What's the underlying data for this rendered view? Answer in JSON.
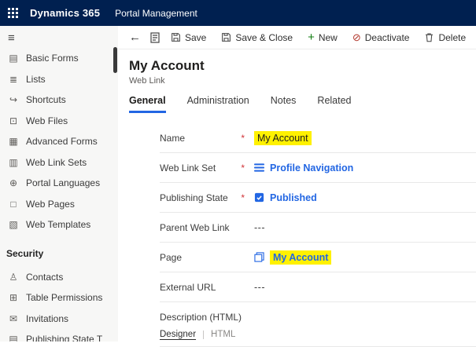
{
  "colors": {
    "topbar_bg": "#002050",
    "link": "#2266E3",
    "highlight": "#fff100",
    "required": "#d13438",
    "green": "#107c10",
    "divider": "#e8e8e8"
  },
  "topbar": {
    "product": "Dynamics 365",
    "app": "Portal Management"
  },
  "sidebar": {
    "hamburger_glyph": "≡",
    "items": [
      {
        "label": "Basic Forms",
        "icon": "basic-forms-icon",
        "glyph": "▤"
      },
      {
        "label": "Lists",
        "icon": "lists-icon",
        "glyph": "≣"
      },
      {
        "label": "Shortcuts",
        "icon": "shortcuts-icon",
        "glyph": "↪"
      },
      {
        "label": "Web Files",
        "icon": "web-files-icon",
        "glyph": "⊡"
      },
      {
        "label": "Advanced Forms",
        "icon": "advanced-forms-icon",
        "glyph": "▦"
      },
      {
        "label": "Web Link Sets",
        "icon": "web-link-sets-icon",
        "glyph": "▥"
      },
      {
        "label": "Portal Languages",
        "icon": "portal-languages-icon",
        "glyph": "⊕"
      },
      {
        "label": "Web Pages",
        "icon": "web-pages-icon",
        "glyph": "□"
      },
      {
        "label": "Web Templates",
        "icon": "web-templates-icon",
        "glyph": "▧"
      }
    ],
    "section_security": "Security",
    "security_items": [
      {
        "label": "Contacts",
        "icon": "contacts-icon",
        "glyph": "♙"
      },
      {
        "label": "Table Permissions",
        "icon": "table-permissions-icon",
        "glyph": "⊞"
      },
      {
        "label": "Invitations",
        "icon": "invitations-icon",
        "glyph": "✉"
      },
      {
        "label": "Publishing State T",
        "icon": "publishing-state-icon",
        "glyph": "▤"
      }
    ]
  },
  "commandbar": {
    "back_glyph": "←",
    "save": "Save",
    "save_close": "Save & Close",
    "plus_glyph": "+",
    "new": "New",
    "deactivate_glyph": "⊘",
    "deactivate": "Deactivate",
    "delete": "Delete",
    "refresh_glyph": "↻"
  },
  "form": {
    "title": "My Account",
    "entity": "Web Link",
    "tabs": [
      {
        "label": "General"
      },
      {
        "label": "Administration"
      },
      {
        "label": "Notes"
      },
      {
        "label": "Related"
      }
    ],
    "fields": [
      {
        "label": "Name",
        "required": "*",
        "value": "My Account"
      },
      {
        "label": "Web Link Set",
        "required": "*",
        "value": "Profile Navigation"
      },
      {
        "label": "Publishing State",
        "required": "*",
        "value": "Published"
      },
      {
        "label": "Parent Web Link",
        "required": "",
        "value": "---"
      },
      {
        "label": "Page",
        "required": "",
        "value": "My Account"
      },
      {
        "label": "External URL",
        "required": "",
        "value": "---"
      }
    ],
    "description": {
      "label": "Description (HTML)",
      "tab_designer": "Designer",
      "tab_html": "HTML"
    }
  }
}
